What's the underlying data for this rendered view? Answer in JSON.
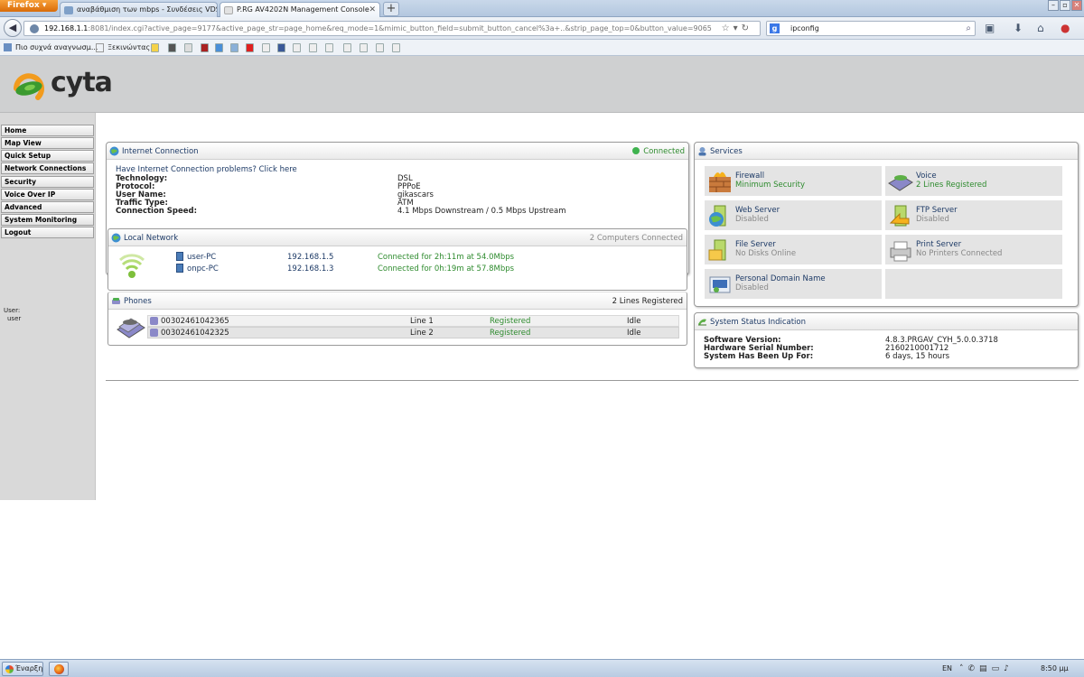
{
  "browser": {
    "app_button": "Firefox",
    "tabs": [
      {
        "label": "αναβάθμιση των mbps - Συνδέσεις VDSL ...",
        "active": false
      },
      {
        "label": "P.RG AV4202N Management Console",
        "active": true
      }
    ],
    "url_host": "192.168.1.1",
    "url_rest": ":8081/index.cgi?active_page=9177&active_page_str=page_home&req_mode=1&mimic_button_field=submit_button_cancel%3a+..&strip_page_top=0&button_value=9065",
    "search_value": "ipconfig",
    "bookmarks": [
      "Πιο συχνά αναγνωσμ...",
      "Ξεκινώντας"
    ]
  },
  "brand": {
    "name": "cyta",
    "colors": {
      "orange": "#f29b1d",
      "green": "#3b9a2f",
      "blue": "#1d3a66"
    }
  },
  "sidebar": {
    "items": [
      "Home",
      "Map View",
      "Quick Setup",
      "Network Connections",
      "Security",
      "Voice Over IP",
      "Advanced",
      "System Monitoring",
      "Logout"
    ],
    "user_label": "User:",
    "user_name": "user"
  },
  "internet": {
    "title": "Internet Connection",
    "status": "Connected",
    "problem_link": "Have Internet Connection problems? Click here",
    "rows": [
      {
        "label": "Technology:",
        "value": "DSL"
      },
      {
        "label": "Protocol:",
        "value": "PPPoE"
      },
      {
        "label": "User Name:",
        "value": "gikascars"
      },
      {
        "label": "Traffic Type:",
        "value": "ATM"
      },
      {
        "label": "Connection Speed:",
        "value": "4.1 Mbps Downstream / 0.5 Mbps Upstream"
      }
    ]
  },
  "local_network": {
    "title": "Local Network",
    "summary": "2 Computers Connected",
    "hosts": [
      {
        "name": "user-PC",
        "ip": "192.168.1.5",
        "status": "Connected for 2h:11m at 54.0Mbps"
      },
      {
        "name": "onpc-PC",
        "ip": "192.168.1.3",
        "status": "Connected for 0h:19m at 57.8Mbps"
      }
    ]
  },
  "phones": {
    "title": "Phones",
    "summary": "2 Lines Registered",
    "lines": [
      {
        "number": "00302461042365",
        "line": "Line 1",
        "reg": "Registered",
        "state": "Idle"
      },
      {
        "number": "00302461042325",
        "line": "Line 2",
        "reg": "Registered",
        "state": "Idle"
      }
    ]
  },
  "services": {
    "title": "Services",
    "items": [
      {
        "name": "Firewall",
        "status": "Minimum Security",
        "tone": "green",
        "icon": "firewall-icon"
      },
      {
        "name": "Voice",
        "status": "2 Lines Registered",
        "tone": "green",
        "icon": "voice-phone-icon"
      },
      {
        "name": "Web Server",
        "status": "Disabled",
        "tone": "grey",
        "icon": "web-server-icon"
      },
      {
        "name": "FTP Server",
        "status": "Disabled",
        "tone": "grey",
        "icon": "ftp-server-icon"
      },
      {
        "name": "File Server",
        "status": "No Disks Online",
        "tone": "grey",
        "icon": "file-server-icon"
      },
      {
        "name": "Print Server",
        "status": "No Printers Connected",
        "tone": "grey",
        "icon": "printer-icon"
      },
      {
        "name": "Personal Domain Name",
        "status": "Disabled",
        "tone": "grey",
        "icon": "domain-name-icon"
      }
    ]
  },
  "system": {
    "title": "System Status Indication",
    "rows": [
      {
        "label": "Software Version:",
        "value": "4.8.3.PRGAV_CYH_5.0.0.3718"
      },
      {
        "label": "Hardware Serial Number:",
        "value": "2160210001712"
      },
      {
        "label": "System Has Been Up For:",
        "value": "6 days, 15 hours"
      }
    ]
  },
  "taskbar": {
    "start_label": "Έναρξη",
    "language": "EN",
    "time": "8:50 μμ"
  }
}
